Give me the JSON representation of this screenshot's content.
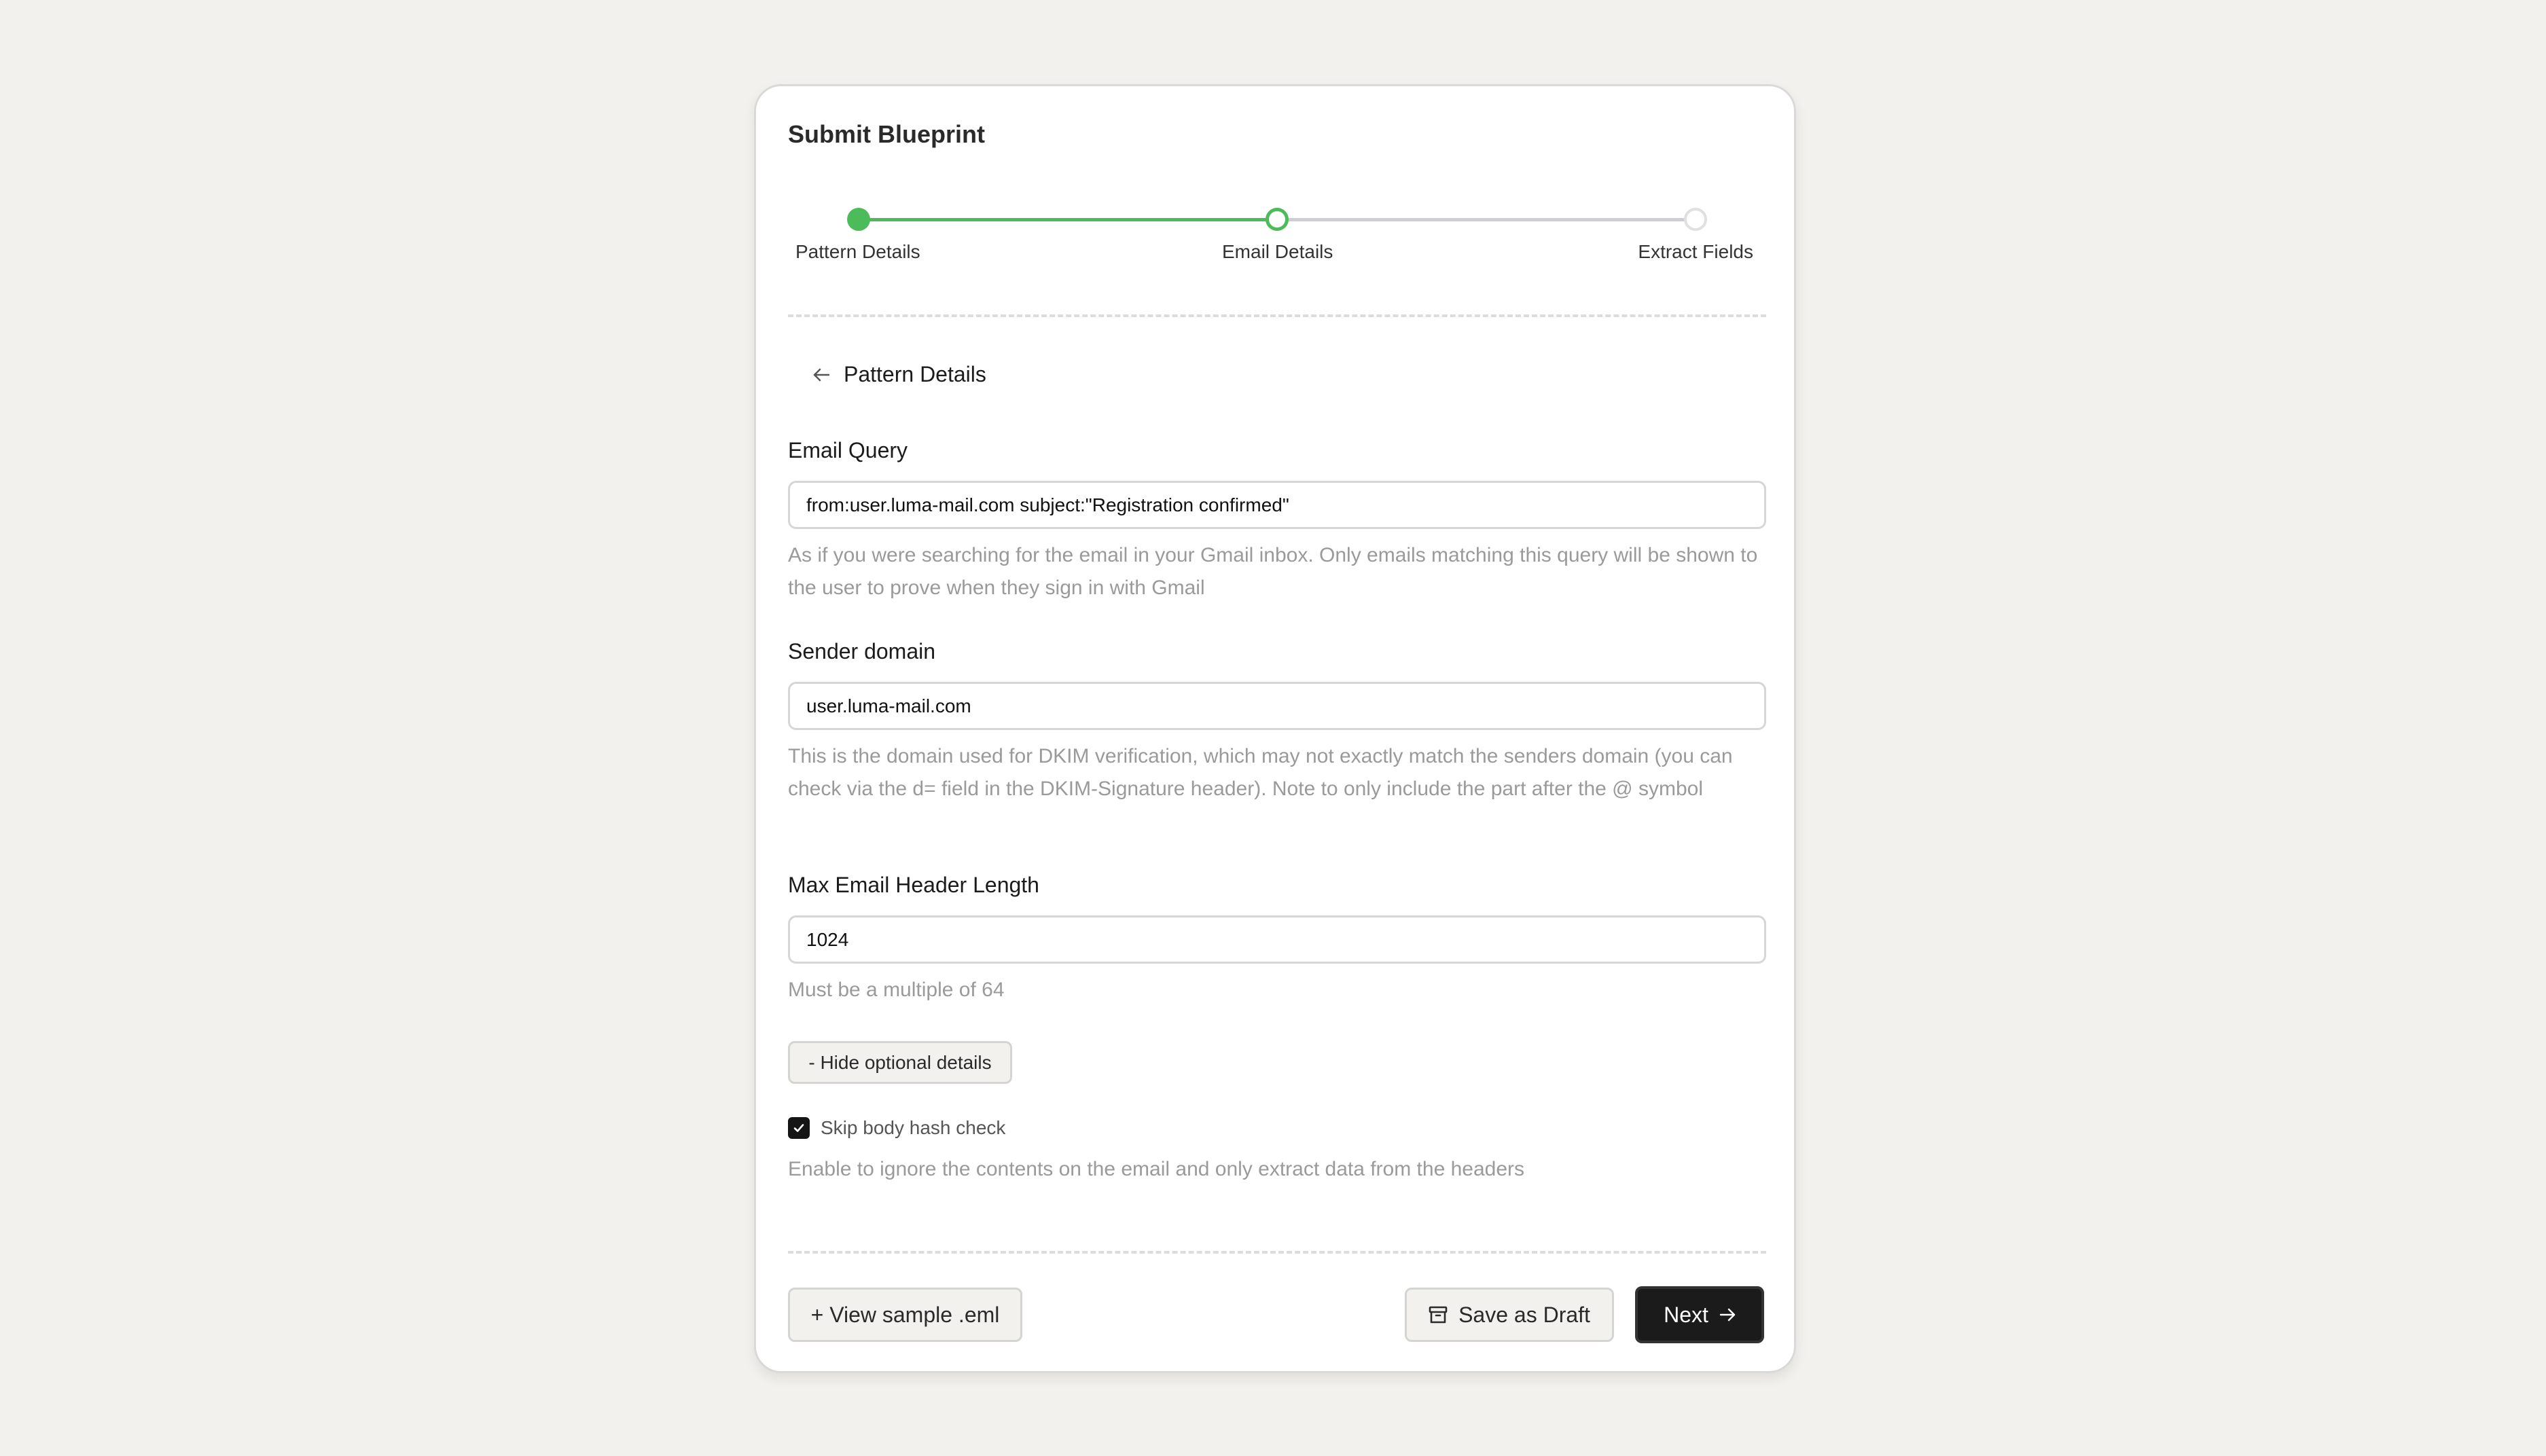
{
  "card": {
    "title": "Submit Blueprint"
  },
  "stepper": {
    "steps": [
      {
        "label": "Pattern Details",
        "state": "completed"
      },
      {
        "label": "Email Details",
        "state": "current"
      },
      {
        "label": "Extract Fields",
        "state": "upcoming"
      }
    ],
    "progress_fraction": 0.5,
    "colors": {
      "active": "#4CBB5A",
      "inactive": "#CDCFD4"
    }
  },
  "back_link": {
    "icon": "arrow-left-icon",
    "label": "Pattern Details"
  },
  "fields": {
    "email_query": {
      "label": "Email Query",
      "value": "from:user.luma-mail.com subject:\"Registration confirmed\"",
      "help": "As if you were searching for the email in your Gmail inbox. Only emails matching this query will be shown to the user to prove when they sign in with Gmail"
    },
    "sender_domain": {
      "label": "Sender domain",
      "value": "user.luma-mail.com",
      "help": "This is the domain used for DKIM verification, which may not exactly match the senders domain (you can check via the d= field in the DKIM-Signature header). Note to only include the part after the @ symbol"
    },
    "max_header_length": {
      "label": "Max Email Header Length",
      "value": "1024",
      "help": "Must be a multiple of 64"
    }
  },
  "optional": {
    "toggle_label": "- Hide optional details",
    "skip_body_hash": {
      "label": "Skip body hash check",
      "checked": true,
      "help": "Enable to ignore the contents on the email and only extract data from the headers"
    }
  },
  "footer": {
    "view_sample_label": "+ View sample .eml",
    "save_draft_label": "Save as Draft",
    "save_draft_icon": "archive-icon",
    "next_label": "Next",
    "next_icon": "arrow-right-icon"
  }
}
